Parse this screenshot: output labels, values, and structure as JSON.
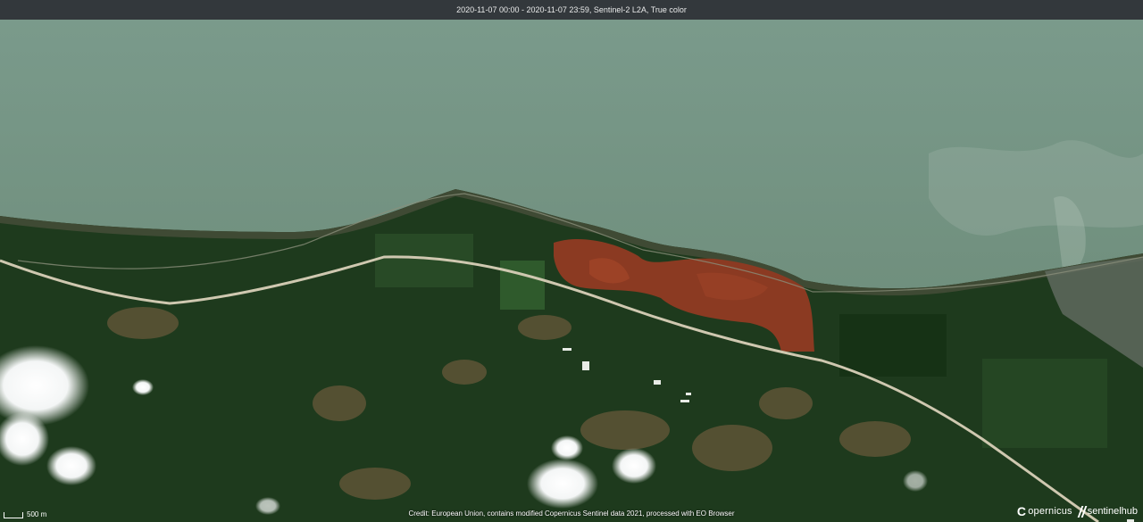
{
  "header": {
    "title": "2020-11-07 00:00 - 2020-11-07 23:59, Sentinel-2 L2A, True color"
  },
  "scale": {
    "label": "500 m"
  },
  "credit": {
    "text": "Credit: European Union, contains modified Copernicus Sentinel data 2021, processed with EO Browser"
  },
  "logos": {
    "copernicus": "opernicus",
    "copernicus_mark": "C",
    "sentinelhub": "sentinelhub"
  },
  "colors": {
    "sea": "#6f8b78",
    "land": "#1f3a1e",
    "bare_soil": "#8a3a22",
    "road": "#cfc8b0",
    "header_bg": "#33383c"
  }
}
